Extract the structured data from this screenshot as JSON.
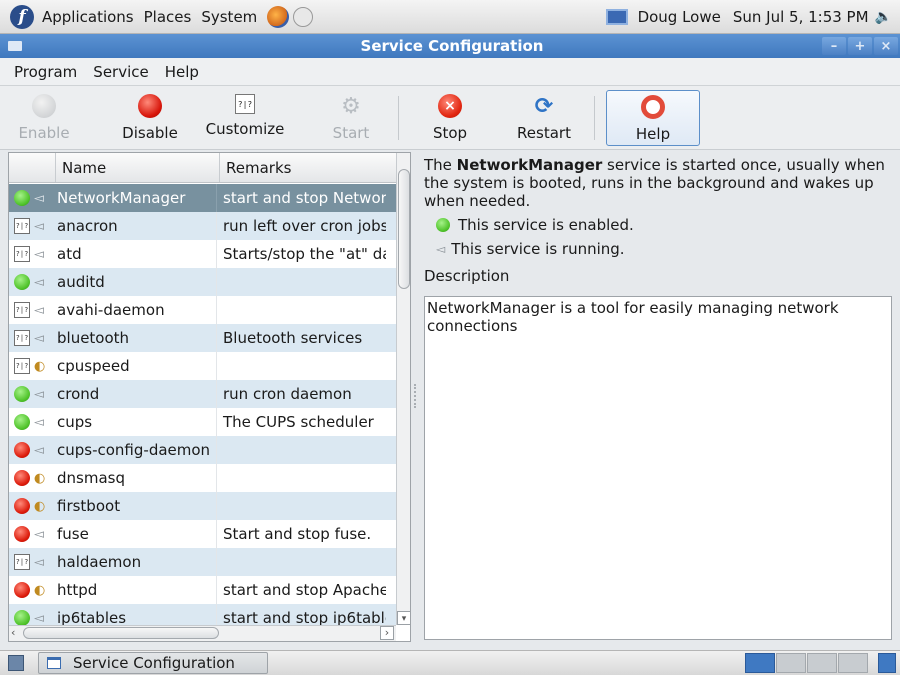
{
  "top_panel": {
    "menus": [
      "Applications",
      "Places",
      "System"
    ],
    "user": "Doug Lowe",
    "clock": "Sun Jul  5,  1:53 PM"
  },
  "window": {
    "title": "Service Configuration",
    "controls": [
      "minimize",
      "maximize",
      "close"
    ]
  },
  "menubar": {
    "items": [
      "Program",
      "Service",
      "Help"
    ]
  },
  "toolbar": {
    "enable": "Enable",
    "disable": "Disable",
    "customize": "Customize",
    "start": "Start",
    "stop": "Stop",
    "restart": "Restart",
    "help": "Help"
  },
  "service_list": {
    "columns": [
      "Name",
      "Remarks"
    ],
    "rows": [
      {
        "name": "NetworkManager",
        "remark": "start and stop Networ",
        "status": "enabled",
        "selected": true,
        "kind": "service"
      },
      {
        "name": "anacron",
        "remark": "run left over cron jobs",
        "status": "custom",
        "kind": "service"
      },
      {
        "name": "atd",
        "remark": "Starts/stop the \"at\" da",
        "status": "custom",
        "kind": "service"
      },
      {
        "name": "auditd",
        "remark": "",
        "status": "enabled",
        "kind": "service"
      },
      {
        "name": "avahi-daemon",
        "remark": "",
        "status": "custom",
        "kind": "service"
      },
      {
        "name": "bluetooth",
        "remark": "Bluetooth services",
        "status": "custom",
        "kind": "service"
      },
      {
        "name": "cpuspeed",
        "remark": "",
        "status": "custom",
        "kind": "xinetd"
      },
      {
        "name": "crond",
        "remark": "run cron daemon",
        "status": "enabled",
        "kind": "service"
      },
      {
        "name": "cups",
        "remark": "The CUPS scheduler",
        "status": "enabled",
        "kind": "service"
      },
      {
        "name": "cups-config-daemon",
        "remark": "",
        "status": "disabled",
        "kind": "service"
      },
      {
        "name": "dnsmasq",
        "remark": "",
        "status": "disabled",
        "kind": "xinetd"
      },
      {
        "name": "firstboot",
        "remark": "",
        "status": "disabled",
        "kind": "xinetd"
      },
      {
        "name": "fuse",
        "remark": "Start and stop fuse.",
        "status": "disabled",
        "kind": "service"
      },
      {
        "name": "haldaemon",
        "remark": "",
        "status": "custom",
        "kind": "service"
      },
      {
        "name": "httpd",
        "remark": "start and stop Apache",
        "status": "disabled",
        "kind": "xinetd"
      },
      {
        "name": "ip6tables",
        "remark": "start and stop ip6table",
        "status": "enabled",
        "kind": "service"
      }
    ]
  },
  "details": {
    "summary_prefix": "The ",
    "summary_service": "NetworkManager",
    "summary_suffix": " service is started once, usually when the system is booted, runs in the background and wakes up when needed.",
    "enabled_text": "This service is enabled.",
    "running_text": "This service is running.",
    "description_label": "Description",
    "description": "NetworkManager is a tool for easily managing network connections"
  },
  "taskbar": {
    "task": "Service Configuration"
  },
  "colors": {
    "title_bar": "#4a82c6",
    "selected_row": "#78919f",
    "stripe_row": "#dbe8f2",
    "enabled_green": "#4fc32a",
    "disabled_red": "#dc1a0a"
  }
}
